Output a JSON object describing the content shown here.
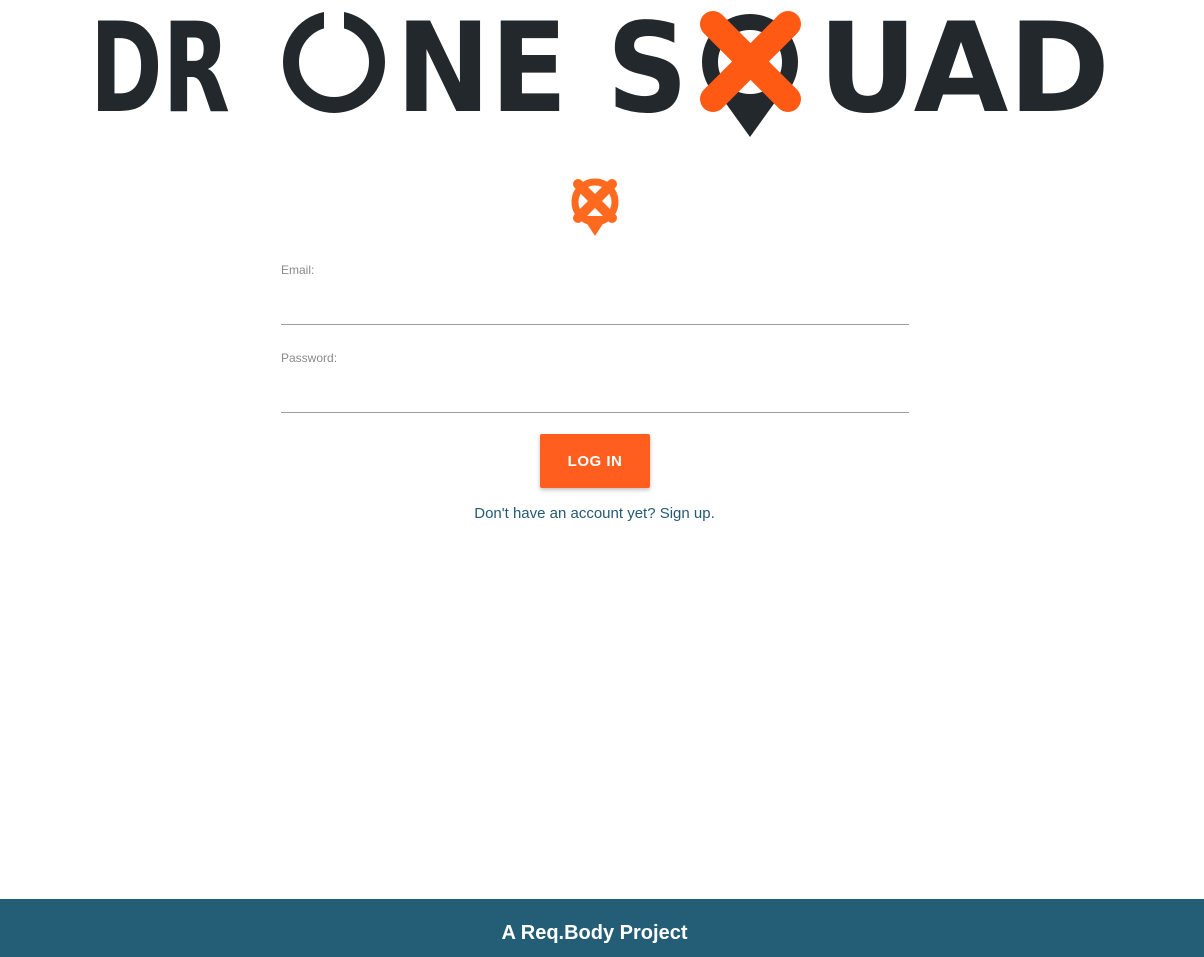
{
  "brand": {
    "name_part1": "DR",
    "name_part2": "NE S",
    "name_part3": "UAD",
    "dark_color": "#22282c",
    "accent_color": "#ff5a14",
    "icon": "x-map-pin-icon"
  },
  "login_form": {
    "email_label": "Email:",
    "email_value": "",
    "password_label": "Password:",
    "password_value": "",
    "submit_label": "LOG IN",
    "signup_text": "Don't have an account yet? Sign up."
  },
  "footer": {
    "text": "A Req.Body Project",
    "background": "#245d76"
  }
}
